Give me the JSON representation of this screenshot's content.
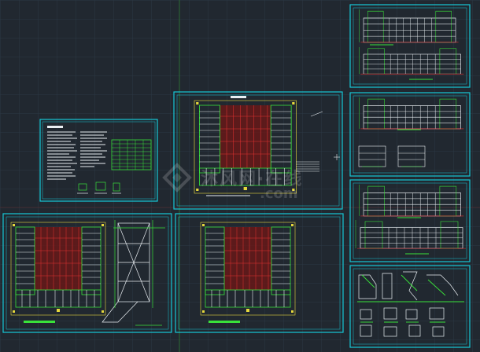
{
  "app": {
    "title": "",
    "background": "#212830",
    "grid_color": "#2c3844",
    "frame_color": "#16c7d6",
    "line_green": "#39e23a",
    "line_red": "#e23232",
    "line_yellow": "#e6d83c",
    "line_white": "#e9eef2"
  },
  "sheets": [
    {
      "id": "design-notes-sheet",
      "kind": "notes"
    },
    {
      "id": "site-plan-sheet",
      "kind": "plan"
    },
    {
      "id": "floor-plan-1-sheet",
      "kind": "plan-with-stair"
    },
    {
      "id": "floor-plan-2-sheet",
      "kind": "plan"
    },
    {
      "id": "elevation-sheet-1",
      "kind": "elevation"
    },
    {
      "id": "elevation-sheet-2",
      "kind": "elevation-detail"
    },
    {
      "id": "elevation-sheet-3",
      "kind": "elevation"
    },
    {
      "id": "detail-sheet",
      "kind": "details"
    }
  ],
  "watermark": {
    "text_cn": "沐风网·在线",
    "text_en": ".com",
    "icon": "mufeng-logo-icon"
  }
}
